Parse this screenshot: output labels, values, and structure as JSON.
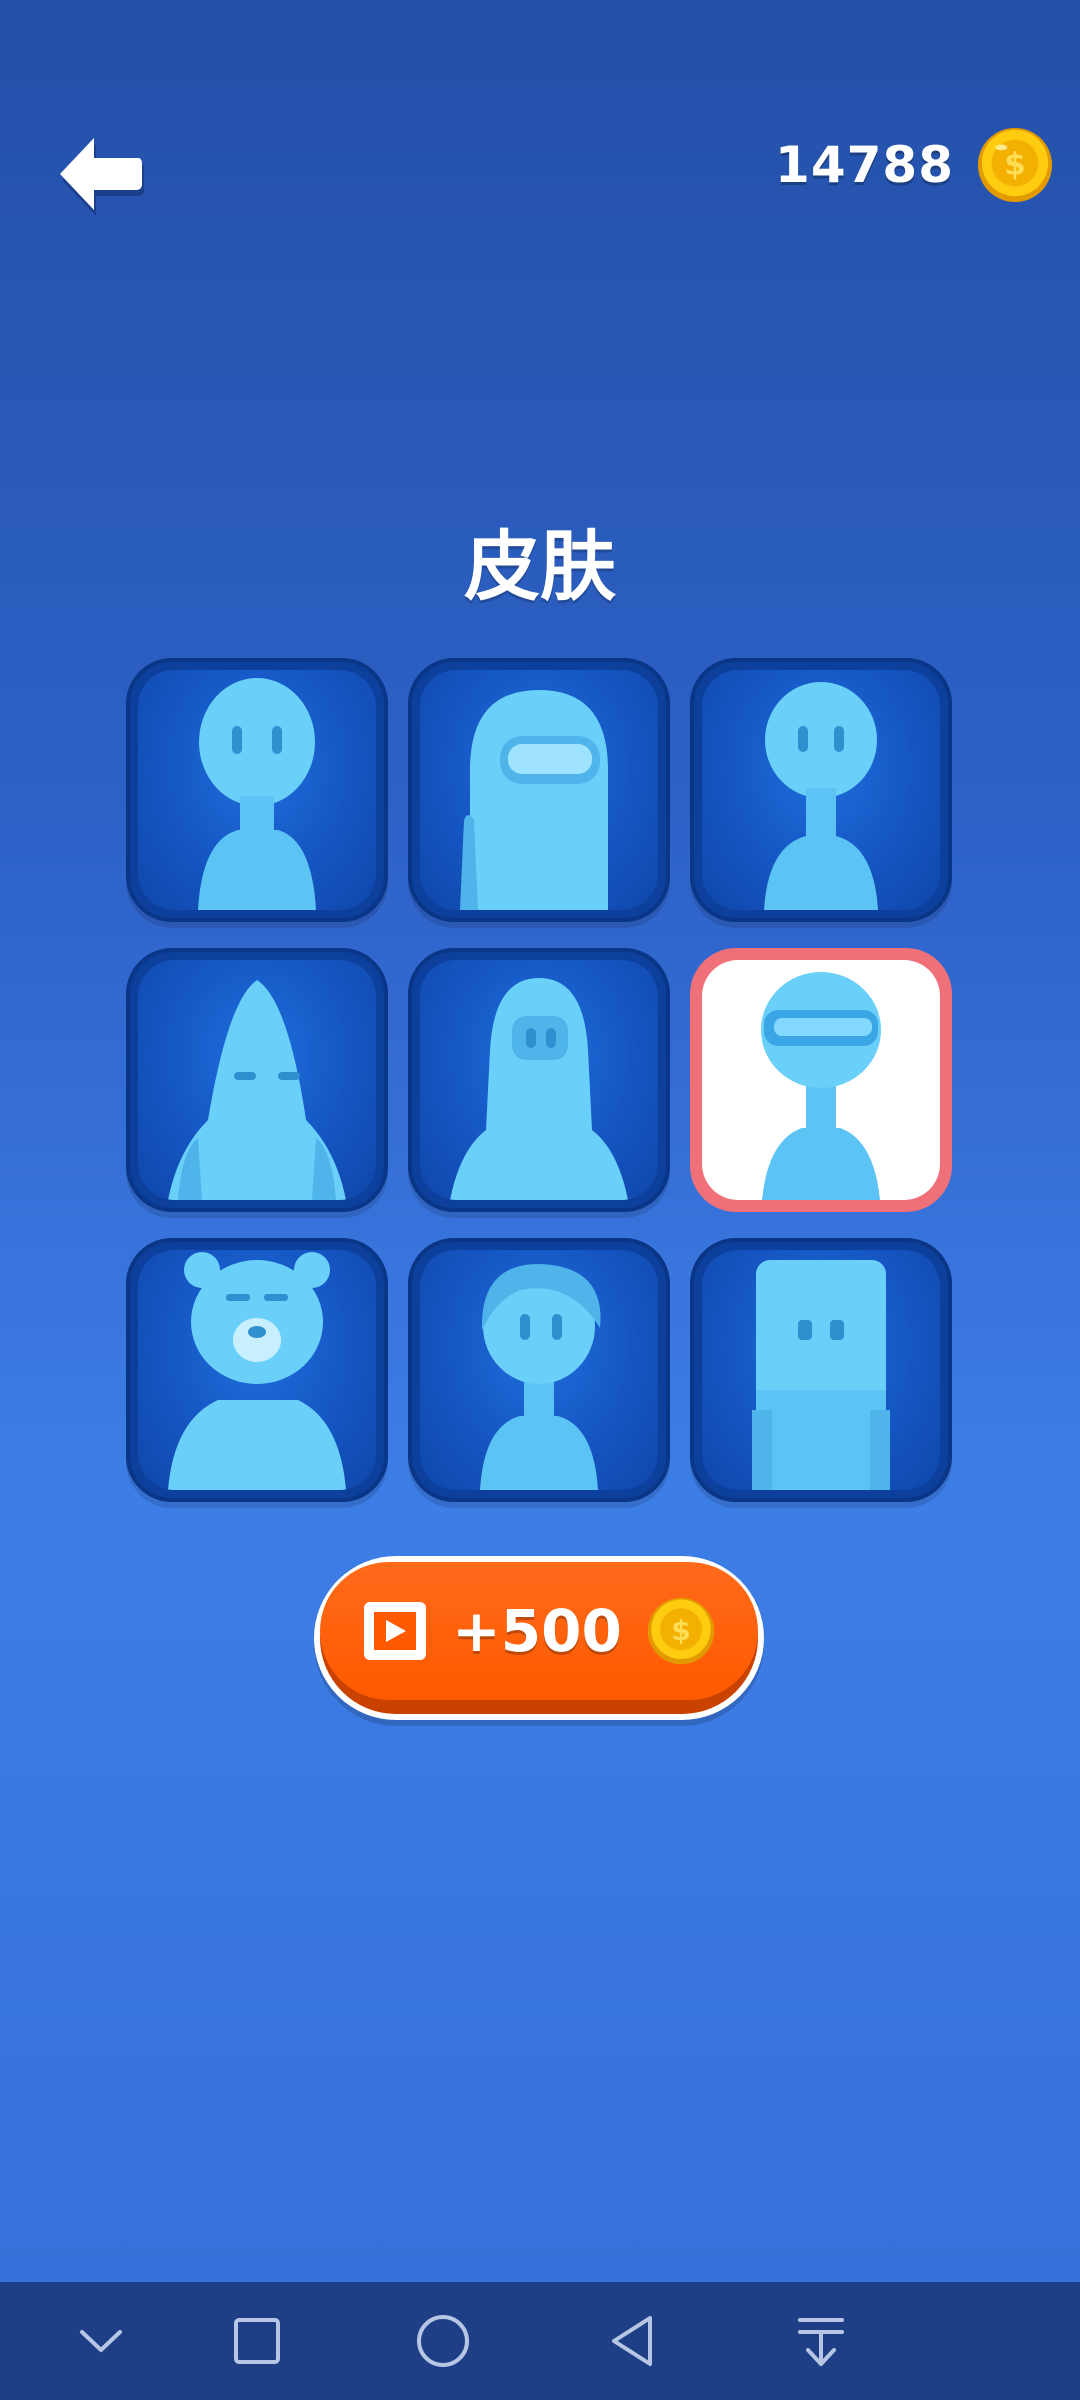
{
  "header": {
    "coins": "14788",
    "back_icon": "back-arrow-icon",
    "coin_icon": "coin-icon"
  },
  "title": "皮肤",
  "skins": [
    {
      "name": "bean-figure",
      "selected": false
    },
    {
      "name": "crewmate",
      "selected": false
    },
    {
      "name": "slim-figure",
      "selected": false
    },
    {
      "name": "cone-head",
      "selected": false
    },
    {
      "name": "hooded-figure",
      "selected": false
    },
    {
      "name": "visor-robot",
      "selected": true
    },
    {
      "name": "bear",
      "selected": false
    },
    {
      "name": "short-hair-figure",
      "selected": false
    },
    {
      "name": "block-head",
      "selected": false
    }
  ],
  "reward_button": {
    "label": "+500",
    "icon": "video-ad-icon",
    "coin_icon": "coin-icon"
  },
  "colors": {
    "figure": "#5cc4f5",
    "selected_border": "#f0707a",
    "button_orange": "#ff5a00",
    "coin_gold": "#f6b800"
  },
  "nav_bar": [
    "chevron-down-icon",
    "square-icon",
    "circle-icon",
    "triangle-back-icon",
    "download-icon"
  ]
}
